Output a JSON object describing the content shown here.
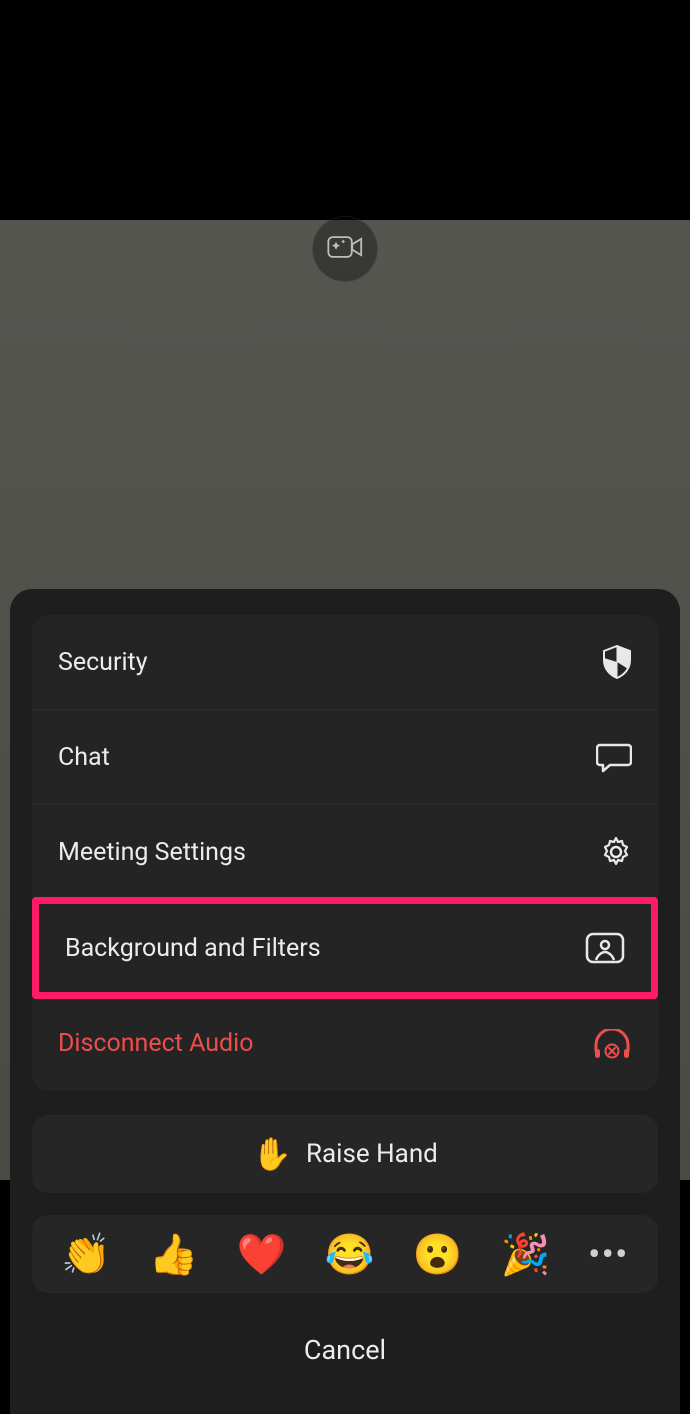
{
  "menu": {
    "items": [
      {
        "label": "Security"
      },
      {
        "label": "Chat"
      },
      {
        "label": "Meeting Settings"
      },
      {
        "label": "Background and Filters",
        "highlighted": true
      },
      {
        "label": "Disconnect Audio",
        "danger": true
      }
    ]
  },
  "raise_hand": {
    "label": "Raise Hand",
    "emoji": "✋"
  },
  "reactions": {
    "items": [
      "👏",
      "👍",
      "❤️",
      "😂",
      "😮",
      "🎉"
    ]
  },
  "cancel_label": "Cancel"
}
